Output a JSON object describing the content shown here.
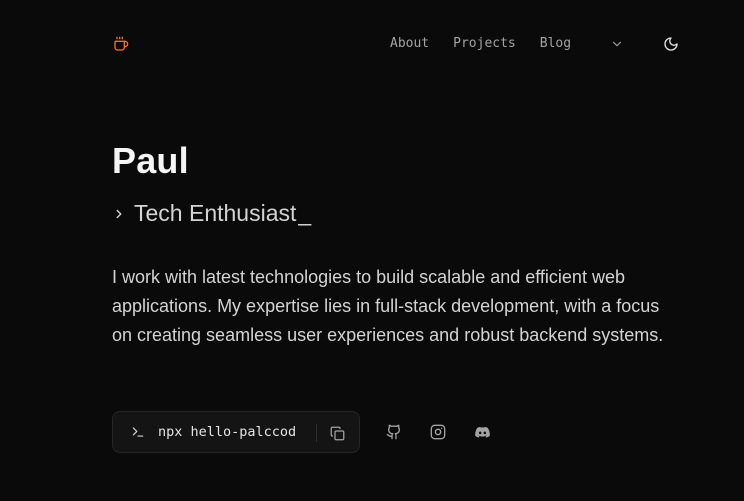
{
  "nav": {
    "logo_icon": "coffee-cup-icon",
    "links": [
      "About",
      "Projects",
      "Blog"
    ],
    "more_icon": "chevron-down-icon",
    "theme_icon": "moon-icon"
  },
  "hero": {
    "name": "Paul",
    "tagline": "Tech Enthusiast",
    "cursor": "_",
    "bio": "I work with latest technologies to build scalable and efficient web applications. My expertise lies in full-stack development, with a focus on creating seamless user experiences and robust backend systems."
  },
  "command": {
    "prompt_icon": "terminal-prompt-icon",
    "text": "npx hello-palccod",
    "copy_icon": "copy-icon"
  },
  "social": [
    "github-icon",
    "instagram-icon",
    "discord-icon"
  ],
  "colors": {
    "background": "#0a0a0a",
    "accent": "#f97316",
    "text": "#e5e5e5"
  }
}
